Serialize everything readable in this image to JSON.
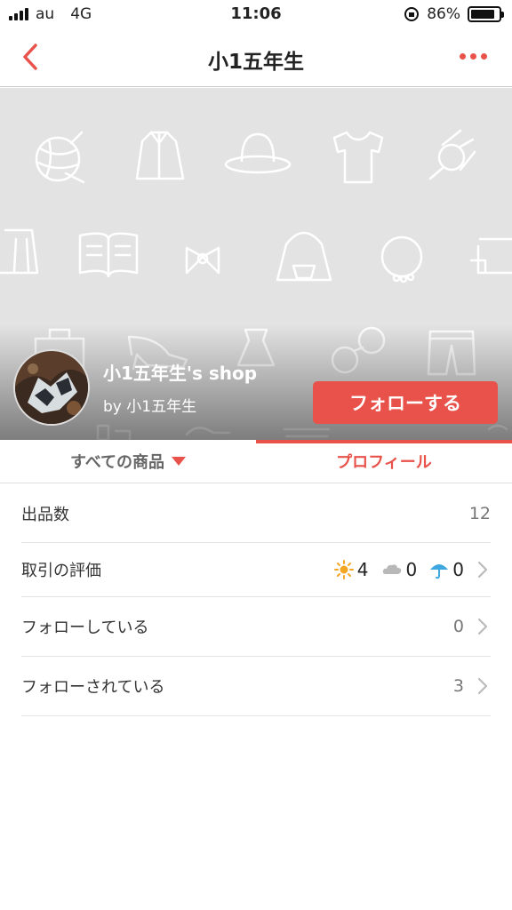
{
  "status_bar": {
    "carrier": "au",
    "network": "4G",
    "time": "11:06",
    "battery": "86%",
    "battery_level": 0.86
  },
  "nav": {
    "title": "小1五年生",
    "back_icon": "chevron-left-icon",
    "more_icon": "more-dots-icon"
  },
  "header": {
    "shop_name": "小1五年生's shop",
    "owner": "by 小1五年生",
    "follow_button": "フォローする"
  },
  "tabs": [
    {
      "label": "すべての商品",
      "active": false
    },
    {
      "label": "プロフィール",
      "active": true
    }
  ],
  "profile": {
    "listings": {
      "label": "出品数",
      "value": "12"
    },
    "ratings": {
      "label": "取引の評価",
      "good": "4",
      "normal": "0",
      "bad": "0"
    },
    "following": {
      "label": "フォローしている",
      "value": "0"
    },
    "followers": {
      "label": "フォローされている",
      "value": "3"
    }
  },
  "colors": {
    "accent": "#e8524a",
    "sun": "#f5a623",
    "umbrella": "#3ea7e0",
    "cloud": "#b8b8b8"
  }
}
